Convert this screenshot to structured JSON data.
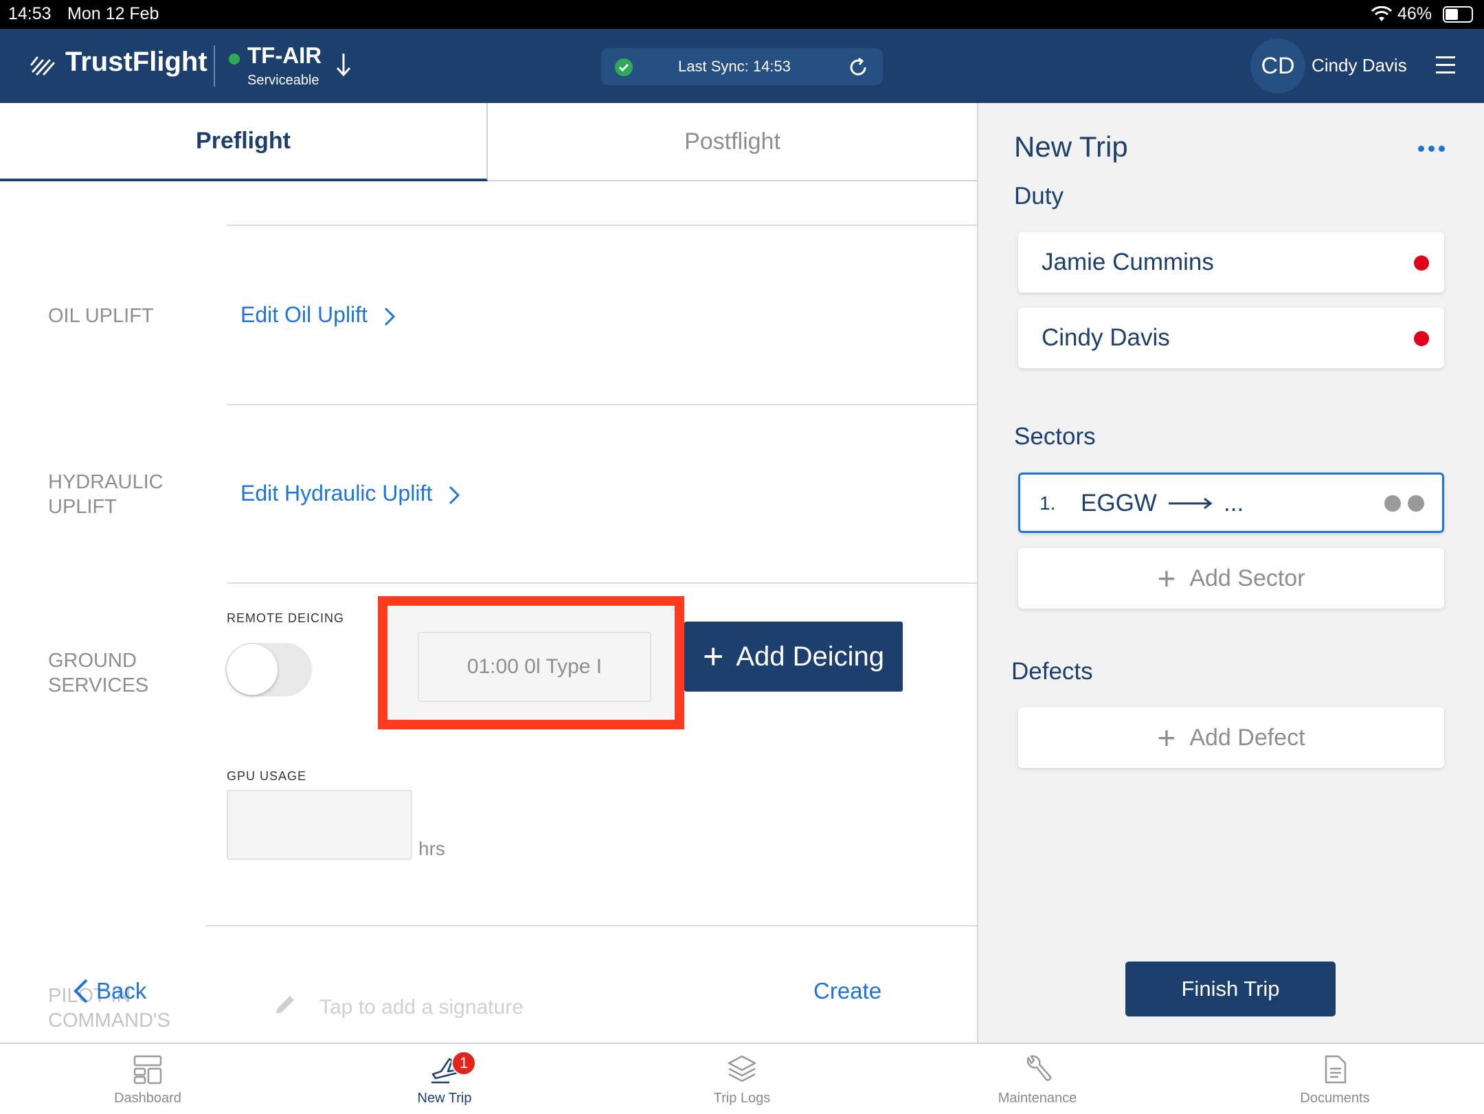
{
  "status_bar": {
    "time": "14:53",
    "date": "Mon 12 Feb",
    "battery": "46%"
  },
  "header": {
    "brand": "TrustFlight",
    "aircraft": "TF-AIR",
    "aircraft_status": "Serviceable",
    "sync_text": "Last Sync: 14:53",
    "user_initials": "CD",
    "user_name": "Cindy Davis"
  },
  "tabs": [
    {
      "label": "Preflight",
      "active": true
    },
    {
      "label": "Postflight",
      "active": false
    }
  ],
  "form": {
    "oil_uplift_label": "OIL UPLIFT",
    "oil_uplift_link": "Edit Oil Uplift",
    "hydraulic_label_1": "HYDRAULIC",
    "hydraulic_label_2": "UPLIFT",
    "hydraulic_link": "Edit Hydraulic Uplift",
    "ground_label_1": "GROUND",
    "ground_label_2": "SERVICES",
    "remote_deicing_label": "REMOTE DEICING",
    "remote_deicing_on": false,
    "deicing_entry": "01:00 0l Type I",
    "add_deicing_label": "Add Deicing",
    "gpu_usage_label": "GPU USAGE",
    "gpu_usage_value": "",
    "gpu_unit": "hrs",
    "pic_label_1": "PILOT IN",
    "pic_label_2": "COMMAND'S",
    "signature_placeholder": "Tap to add a signature",
    "back_label": "Back",
    "create_label": "Create"
  },
  "side_panel": {
    "title": "New Trip",
    "duty_title": "Duty",
    "duty": [
      {
        "name": "Jamie Cummins"
      },
      {
        "name": "Cindy Davis"
      }
    ],
    "sectors_title": "Sectors",
    "sector": {
      "index": "1.",
      "from": "EGGW",
      "to": "..."
    },
    "add_sector_label": "Add Sector",
    "defects_title": "Defects",
    "add_defect_label": "Add Defect",
    "finish_trip_label": "Finish Trip"
  },
  "bottom_nav": [
    {
      "label": "Dashboard",
      "icon": "dashboard-icon"
    },
    {
      "label": "New Trip",
      "icon": "plane-icon",
      "badge": "1",
      "active": true
    },
    {
      "label": "Trip Logs",
      "icon": "layers-icon"
    },
    {
      "label": "Maintenance",
      "icon": "wrench-icon"
    },
    {
      "label": "Documents",
      "icon": "document-icon"
    }
  ],
  "colors": {
    "header_bg": "#1c3f6e",
    "link_blue": "#1f74d9",
    "highlight_red": "#ff3b1f",
    "status_dot_red": "#e0001b",
    "sync_green": "#2eaa56"
  }
}
